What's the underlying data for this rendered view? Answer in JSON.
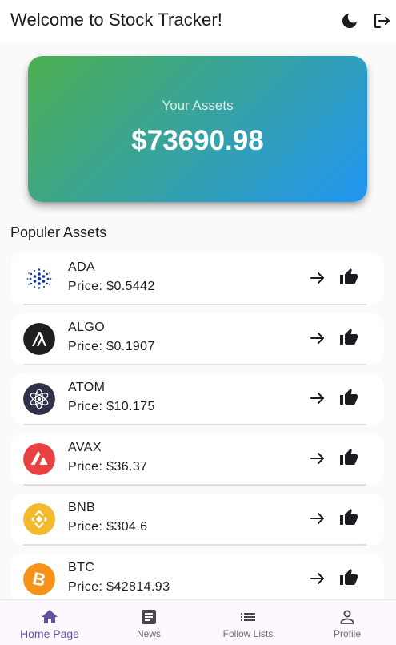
{
  "app": {
    "title": "Welcome to Stock Tracker!",
    "actions": [
      {
        "icon": "moon-icon"
      },
      {
        "icon": "logout-icon"
      }
    ]
  },
  "summary": {
    "label": "Your Assets",
    "value": "$73690.98",
    "gradient": [
      "#4caf50",
      "#2196f3"
    ]
  },
  "section_title": "Populer Assets",
  "assets": [
    {
      "symbol": "ADA",
      "price": "Price: $0.5442",
      "icon": "cardano-icon",
      "color": "#0033ad"
    },
    {
      "symbol": "ALGO",
      "price": "Price: $0.1907",
      "icon": "algorand-icon",
      "color": "#1f1f1f"
    },
    {
      "symbol": "ATOM",
      "price": "Price: $10.175",
      "icon": "cosmos-icon",
      "color": "#2e3148"
    },
    {
      "symbol": "AVAX",
      "price": "Price: $36.37",
      "icon": "avalanche-icon",
      "color": "#e84142"
    },
    {
      "symbol": "BNB",
      "price": "Price: $304.6",
      "icon": "binance-icon",
      "color": "#f3ba2f"
    },
    {
      "symbol": "BTC",
      "price": "Price: $42814.93",
      "icon": "bitcoin-icon",
      "color": "#f7931a"
    }
  ],
  "nav": {
    "active_color": "#6750a4",
    "items": [
      {
        "label": "Home Page",
        "icon": "home-icon",
        "active": true
      },
      {
        "label": "News",
        "icon": "news-icon",
        "active": false
      },
      {
        "label": "Follow Lists",
        "icon": "list-icon",
        "active": false
      },
      {
        "label": "Profile",
        "icon": "profile-icon",
        "active": false
      }
    ]
  }
}
